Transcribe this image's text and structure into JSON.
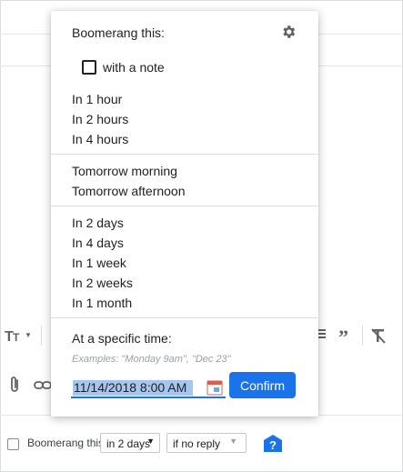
{
  "popup": {
    "title": "Boomerang this:",
    "settings_icon": "gear-icon",
    "note_label": "with a note",
    "hours_options": [
      "In 1 hour",
      "In 2 hours",
      "In 4 hours"
    ],
    "day_options": [
      "Tomorrow morning",
      "Tomorrow afternoon"
    ],
    "later_options": [
      "In 2 days",
      "In 4 days",
      "In 1 week",
      "In 2 weeks",
      "In 1 month"
    ],
    "specific_label": "At a specific time:",
    "examples_hint": "Examples: \"Monday 9am\", \"Dec 23\"",
    "date_value": "11/14/2018 8:00 AM",
    "calendar_icon": "calendar-icon",
    "confirm_label": "Confirm"
  },
  "footer": {
    "boomerang_label": "Boomerang this",
    "days_value": "in 2 days",
    "reply_value": "if no reply",
    "help_icon": "help-icon"
  },
  "colors": {
    "accent": "#1a73e8",
    "selection": "#a7c6ee",
    "divider": "#dadce0",
    "help_badge": "#1a73e8"
  }
}
